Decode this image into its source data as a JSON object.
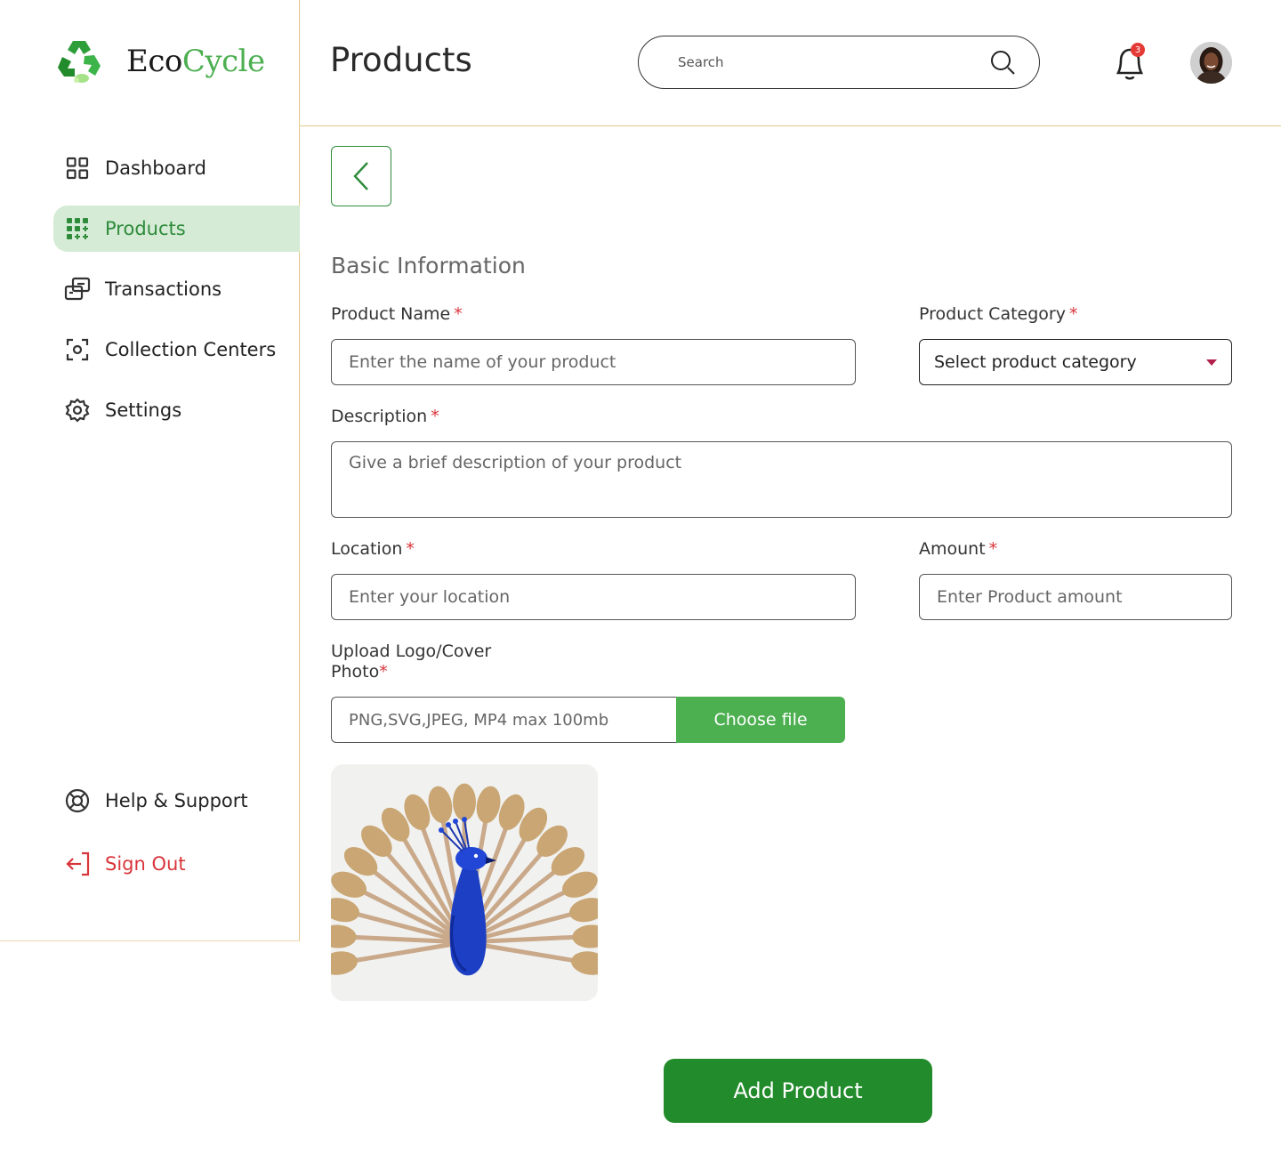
{
  "brand": {
    "part1": "Eco",
    "part2": "Cycle"
  },
  "header": {
    "title": "Products",
    "search_placeholder": "Search",
    "notification_count": "3"
  },
  "sidebar": {
    "items": [
      {
        "label": "Dashboard",
        "icon": "grid-icon"
      },
      {
        "label": "Products",
        "icon": "products-grid-icon",
        "active": true
      },
      {
        "label": "Transactions",
        "icon": "transactions-icon"
      },
      {
        "label": "Collection Centers",
        "icon": "scan-icon"
      },
      {
        "label": "Settings",
        "icon": "gear-icon"
      }
    ],
    "footer": [
      {
        "label": "Help & Support",
        "icon": "lifebuoy-icon"
      },
      {
        "label": "Sign Out",
        "icon": "sign-out-icon"
      }
    ]
  },
  "form": {
    "section_title": "Basic Information",
    "required_mark": "*",
    "product_name": {
      "label": "Product Name",
      "placeholder": "Enter the name of your product"
    },
    "category": {
      "label": "Product Category",
      "value": "Select product category"
    },
    "description": {
      "label": "Description",
      "placeholder": "Give a brief description of your product"
    },
    "location": {
      "label": "Location",
      "placeholder": "Enter your location"
    },
    "amount": {
      "label": "Amount",
      "placeholder": "Enter Product amount"
    },
    "upload": {
      "label_line1": "Upload Logo/Cover",
      "label_line2": "Photo",
      "hint": "PNG,SVG,JPEG, MP4 max 100mb",
      "button": "Choose file"
    },
    "submit": "Add Product"
  },
  "colors": {
    "primary": "#228b2b",
    "accent": "#4caf50",
    "active_bg": "#d5ebd6",
    "danger": "#d9343a",
    "divider": "#e6c98a"
  }
}
